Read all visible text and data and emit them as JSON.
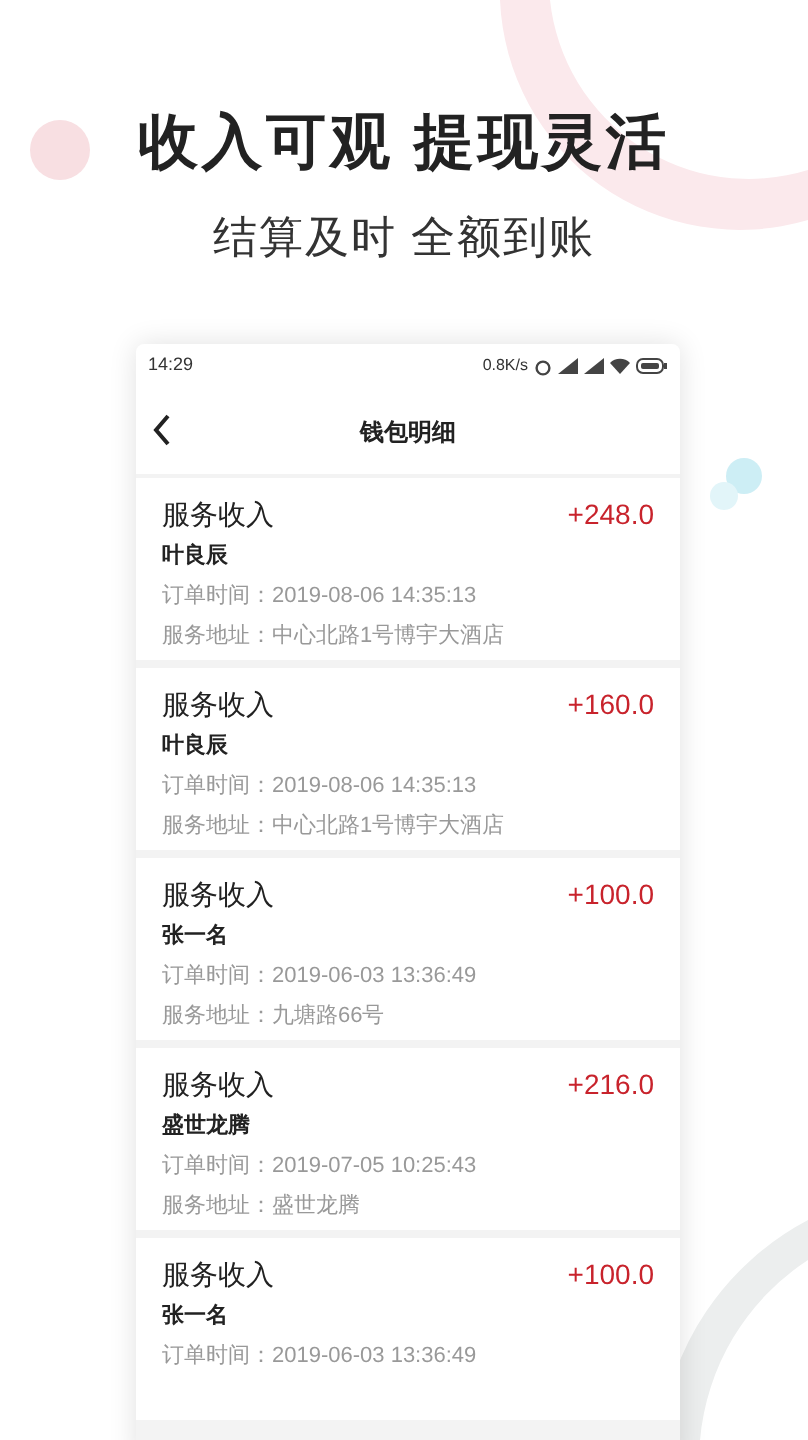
{
  "headline": "收入可观 提现灵活",
  "subheadline": "结算及时 全额到账",
  "phone": {
    "status_bar": {
      "time": "14:29",
      "speed": "0.8K/s"
    },
    "nav": {
      "title": "钱包明细"
    },
    "records": [
      {
        "title": "服务收入",
        "amount": "+248.0",
        "name": "叶良辰",
        "time": "订单时间：2019-08-06 14:35:13",
        "address": "服务地址：中心北路1号博宇大酒店"
      },
      {
        "title": "服务收入",
        "amount": "+160.0",
        "name": "叶良辰",
        "time": "订单时间：2019-08-06 14:35:13",
        "address": "服务地址：中心北路1号博宇大酒店"
      },
      {
        "title": "服务收入",
        "amount": "+100.0",
        "name": "张一名",
        "time": "订单时间：2019-06-03 13:36:49",
        "address": "服务地址：九塘路66号"
      },
      {
        "title": "服务收入",
        "amount": "+216.0",
        "name": "盛世龙腾",
        "time": "订单时间：2019-07-05 10:25:43",
        "address": "服务地址：盛世龙腾"
      },
      {
        "title": "服务收入",
        "amount": "+100.0",
        "name": "张一名",
        "time": "订单时间：2019-06-03 13:36:49"
      }
    ]
  }
}
